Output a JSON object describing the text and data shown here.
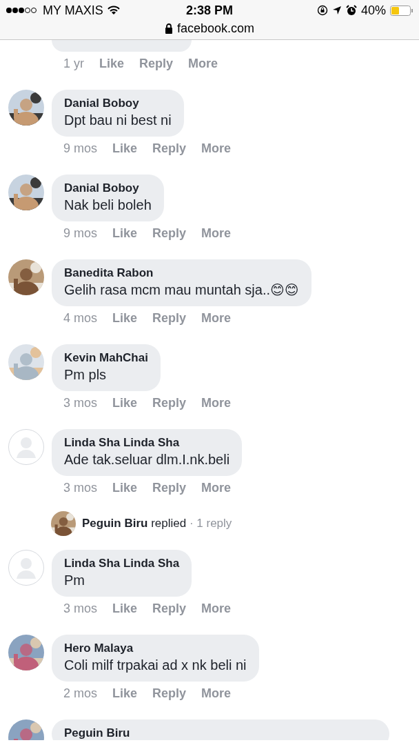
{
  "status_bar": {
    "carrier": "MY MAXIS",
    "time": "2:38 PM",
    "battery": "40%"
  },
  "address_bar": {
    "url": "facebook.com"
  },
  "comments": [
    {
      "kind": "partial",
      "time": "1 yr",
      "actions": [
        "Like",
        "Reply",
        "More"
      ]
    },
    {
      "kind": "comment",
      "author": "Danial Boboy",
      "text": "Dpt bau ni best ni",
      "time": "9 mos",
      "actions": [
        "Like",
        "Reply",
        "More"
      ]
    },
    {
      "kind": "comment",
      "author": "Danial Boboy",
      "text": "Nak beli boleh",
      "time": "9 mos",
      "actions": [
        "Like",
        "Reply",
        "More"
      ]
    },
    {
      "kind": "comment",
      "author": "Banedita Rabon",
      "text": "Gelih rasa mcm mau muntah sja..😊😊",
      "time": "4 mos",
      "actions": [
        "Like",
        "Reply",
        "More"
      ]
    },
    {
      "kind": "comment",
      "author": "Kevin MahChai",
      "text": "Pm pls",
      "time": "3 mos",
      "actions": [
        "Like",
        "Reply",
        "More"
      ]
    },
    {
      "kind": "comment",
      "avatar": {
        "kind": "default"
      },
      "author": "Linda Sha Linda Sha",
      "text": "Ade tak.seluar dlm.I.nk.beli",
      "time": "3 mos",
      "actions": [
        "Like",
        "Reply",
        "More"
      ]
    },
    {
      "kind": "replies",
      "author": "Peguin Biru",
      "verb": "replied",
      "count": "· 1 reply"
    },
    {
      "kind": "comment",
      "avatar": {
        "kind": "default"
      },
      "author": "Linda Sha Linda Sha",
      "text": "Pm",
      "time": "3 mos",
      "actions": [
        "Like",
        "Reply",
        "More"
      ]
    },
    {
      "kind": "comment",
      "author": "Hero Malaya",
      "text": "Coli milf trpakai ad x nk beli ni",
      "time": "2 mos",
      "actions": [
        "Like",
        "Reply",
        "More"
      ]
    },
    {
      "kind": "cut",
      "author": "Peguin Biru"
    }
  ]
}
